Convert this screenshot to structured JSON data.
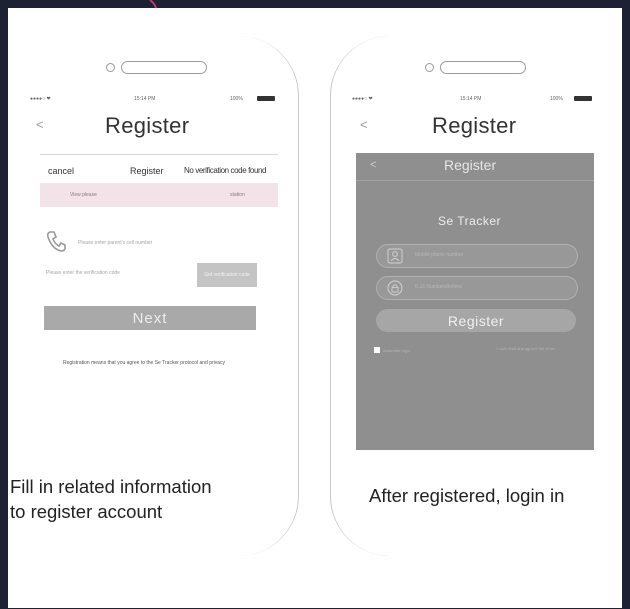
{
  "left_phone": {
    "status": {
      "signal": "●●●●○ ❤",
      "time": "15:14 PM",
      "battery": "100%"
    },
    "back": "<",
    "title": "Register",
    "top_row": {
      "cancel": "cancel",
      "register": "Register",
      "no_code": "No verification code found"
    },
    "notice": {
      "left": "View please",
      "right": "station"
    },
    "phone_placeholder": "Please enter parent's cell number",
    "code_placeholder": "Please enter the verification code",
    "get_code_button": "Get verification code",
    "next_button": "Next",
    "agreement": "Registration means that you agree to the Se Tracker protocol and privacy"
  },
  "right_phone": {
    "status": {
      "signal": "●●●●○ ❤",
      "time": "15:14 PM",
      "battery": "100%"
    },
    "back": "<",
    "title": "Register",
    "inner": {
      "back": "<",
      "title": "Register",
      "brand": "Se Tracker",
      "phone_placeholder": "Mobile phone number",
      "password_placeholder": "6-16 Numbers/letters",
      "register_button": "Register",
      "auto_login": "Automatic login",
      "right_note": "I have read and agreed the terms"
    }
  },
  "captions": {
    "left_line1": "Fill in related information",
    "left_line2": "to register account",
    "right": "After registered, login in"
  }
}
